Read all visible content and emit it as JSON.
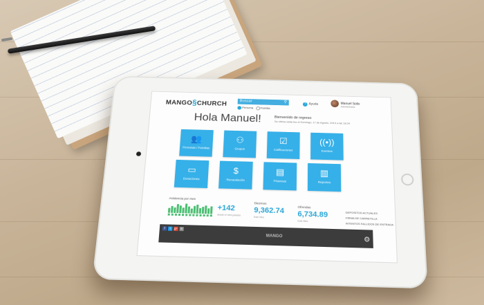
{
  "app": {
    "logo_left": "MANGO",
    "logo_right": "CHURCH"
  },
  "header": {
    "search_placeholder": "Buscar",
    "option_persona": "Persona",
    "option_familia": "Familia",
    "help_label": "Ayuda",
    "user_name": "Manuel Solis",
    "user_sub": "Administrador"
  },
  "greeting": {
    "title": "Hola Manuel!",
    "welcome": "Bienvenido de regreso",
    "last_visit": "Su última visita fue el Domingo, 17 de Agosto, 2013 a las 18:34"
  },
  "tiles": [
    {
      "label": "Personas / Familias",
      "icon": "people-icon"
    },
    {
      "label": "Grupos",
      "icon": "group-icon"
    },
    {
      "label": "Calificaciones",
      "icon": "check-icon"
    },
    {
      "label": "Eventos",
      "icon": "broadcast-icon"
    },
    {
      "label": "Donaciones",
      "icon": "cash-icon"
    },
    {
      "label": "Recaudación",
      "icon": "money-bag-icon"
    },
    {
      "label": "Finanzas",
      "icon": "document-icon"
    },
    {
      "label": "Reportes",
      "icon": "chart-icon"
    }
  ],
  "stats": {
    "attendance_label": "Asistencia por mes",
    "attendance_value": "+142",
    "attendance_sub": "desde el mes pasado",
    "attendance_bars": [
      0.5,
      0.7,
      0.6,
      0.9,
      0.8,
      0.6,
      1.0,
      0.7,
      0.5,
      0.8,
      0.9,
      0.6,
      0.7,
      0.85,
      0.6,
      0.75
    ],
    "tithes_label": "Diezmos",
    "tithes_value": "9,362.74",
    "tithes_sub": "Este Mes",
    "offerings_label": "Ofrendas",
    "offerings_value": "6,734.89",
    "offerings_sub": "Este Mes"
  },
  "side_links": [
    "DEPOSITOS ACTUALES",
    "FIRMA DE CARRETILLA",
    "INTENTOS FALLIDOS DE ENTRADA"
  ],
  "footer": {
    "social": [
      "f",
      "t",
      "g+",
      "in"
    ],
    "logo": "MANGO"
  },
  "colors": {
    "accent": "#36b0e8",
    "bar_green": "#4cbf73",
    "footer": "#3c3c3c"
  }
}
